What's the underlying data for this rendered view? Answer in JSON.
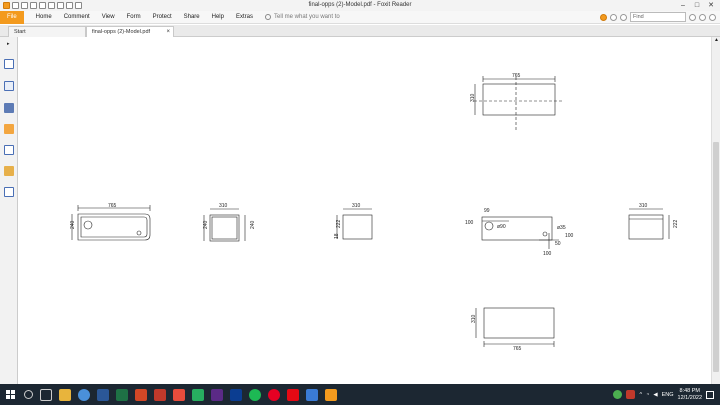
{
  "window": {
    "title": "final-opps (2)-Model.pdf - Foxit Reader",
    "controls": [
      "–",
      "□",
      "✕"
    ]
  },
  "menu": {
    "file": "File",
    "items": [
      "Home",
      "Comment",
      "View",
      "Form",
      "Protect",
      "Share",
      "Help",
      "Extras"
    ],
    "tell_me": "Tell me what you want to",
    "find_placeholder": "Find"
  },
  "tabs": [
    {
      "label": "Start"
    },
    {
      "label": "final-opps (2)-Model.pdf",
      "close": "×"
    }
  ],
  "drawing": {
    "top_view": {
      "width": "765",
      "height": "310"
    },
    "front_view": {
      "width": "765",
      "height": "240"
    },
    "side_left": {
      "width": "310",
      "height": "240",
      "height2": "240"
    },
    "small_box": {
      "width": "310",
      "height": "222",
      "offset": "18"
    },
    "hole_view": {
      "d99": "99",
      "d10": "100",
      "d90": "ø90",
      "d35": "ø35",
      "h100": "100",
      "b100": "100",
      "d50": "50"
    },
    "right_view": {
      "width": "310",
      "height": "222"
    },
    "bottom_view": {
      "width": "765",
      "height": "310"
    }
  },
  "taskbar": {
    "time": "8:48 PM",
    "date": "12/1/2022",
    "lang": "ENG"
  }
}
